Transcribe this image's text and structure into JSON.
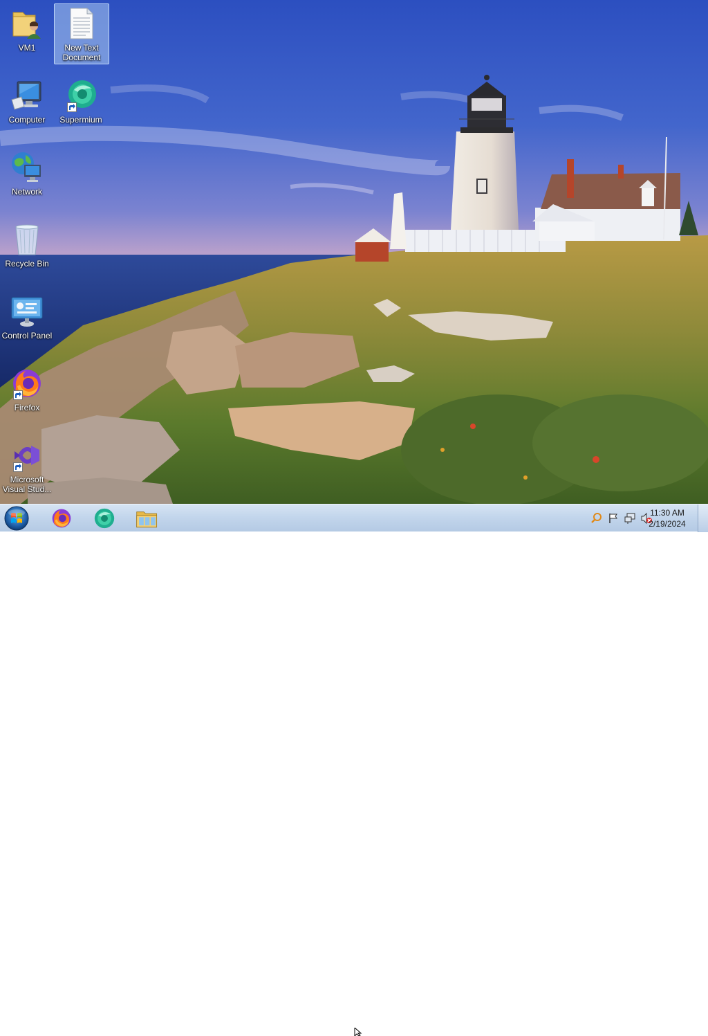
{
  "desktop": {
    "icons": [
      {
        "label": "VM1",
        "icon": "user-folder-icon"
      },
      {
        "label": "New Text Document",
        "icon": "text-document-icon",
        "selected": true
      },
      {
        "label": "Computer",
        "icon": "computer-icon"
      },
      {
        "label": "Supermium",
        "icon": "supermium-browser-icon",
        "shortcut": true
      },
      {
        "label": "Network",
        "icon": "network-icon"
      },
      {
        "label": "Recycle Bin",
        "icon": "recycle-bin-icon"
      },
      {
        "label": "Control Panel",
        "icon": "control-panel-icon"
      },
      {
        "label": "Firefox",
        "icon": "firefox-icon",
        "shortcut": true
      },
      {
        "label": "Microsoft Visual Stud...",
        "icon": "visual-studio-icon",
        "shortcut": true
      }
    ]
  },
  "taskbar": {
    "start": {
      "icon": "windows-start-orb-icon"
    },
    "pinned": [
      {
        "icon": "firefox-icon"
      },
      {
        "icon": "supermium-browser-icon"
      },
      {
        "icon": "file-explorer-icon"
      }
    ],
    "tray": {
      "icons": [
        "search-indexing-icon",
        "action-center-flag-icon",
        "network-tray-icon",
        "volume-muted-icon"
      ],
      "time": "11:30 AM",
      "date": "2/19/2024"
    }
  },
  "colors": {
    "taskbar": "#c3d6ec",
    "selection": "#aac8f0"
  }
}
